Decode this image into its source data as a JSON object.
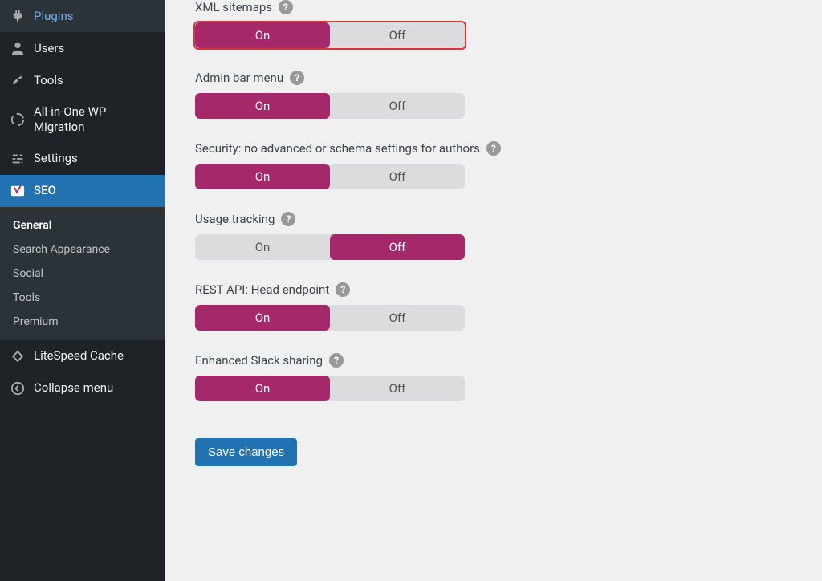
{
  "sidebar": {
    "items": [
      {
        "label": "Plugins",
        "icon": "plug"
      },
      {
        "label": "Users",
        "icon": "user"
      },
      {
        "label": "Tools",
        "icon": "wrench"
      },
      {
        "label": "All-in-One WP Migration",
        "icon": "spinner"
      },
      {
        "label": "Settings",
        "icon": "sliders"
      },
      {
        "label": "SEO",
        "icon": "yoast",
        "active": true
      },
      {
        "label": "LiteSpeed Cache",
        "icon": "diamond"
      }
    ],
    "submenu": [
      {
        "label": "General",
        "current": true
      },
      {
        "label": "Search Appearance"
      },
      {
        "label": "Social"
      },
      {
        "label": "Tools"
      },
      {
        "label": "Premium"
      }
    ],
    "collapse_label": "Collapse menu"
  },
  "settings": [
    {
      "key": "xml_sitemaps",
      "label": "XML sitemaps",
      "state": "on",
      "highlight": true
    },
    {
      "key": "admin_bar_menu",
      "label": "Admin bar menu",
      "state": "on"
    },
    {
      "key": "security_authors",
      "label": "Security: no advanced or schema settings for authors",
      "state": "on"
    },
    {
      "key": "usage_tracking",
      "label": "Usage tracking",
      "state": "off"
    },
    {
      "key": "rest_api_head",
      "label": "REST API: Head endpoint",
      "state": "on"
    },
    {
      "key": "slack_sharing",
      "label": "Enhanced Slack sharing",
      "state": "on"
    }
  ],
  "toggle_labels": {
    "on": "On",
    "off": "Off"
  },
  "save_button": "Save changes"
}
